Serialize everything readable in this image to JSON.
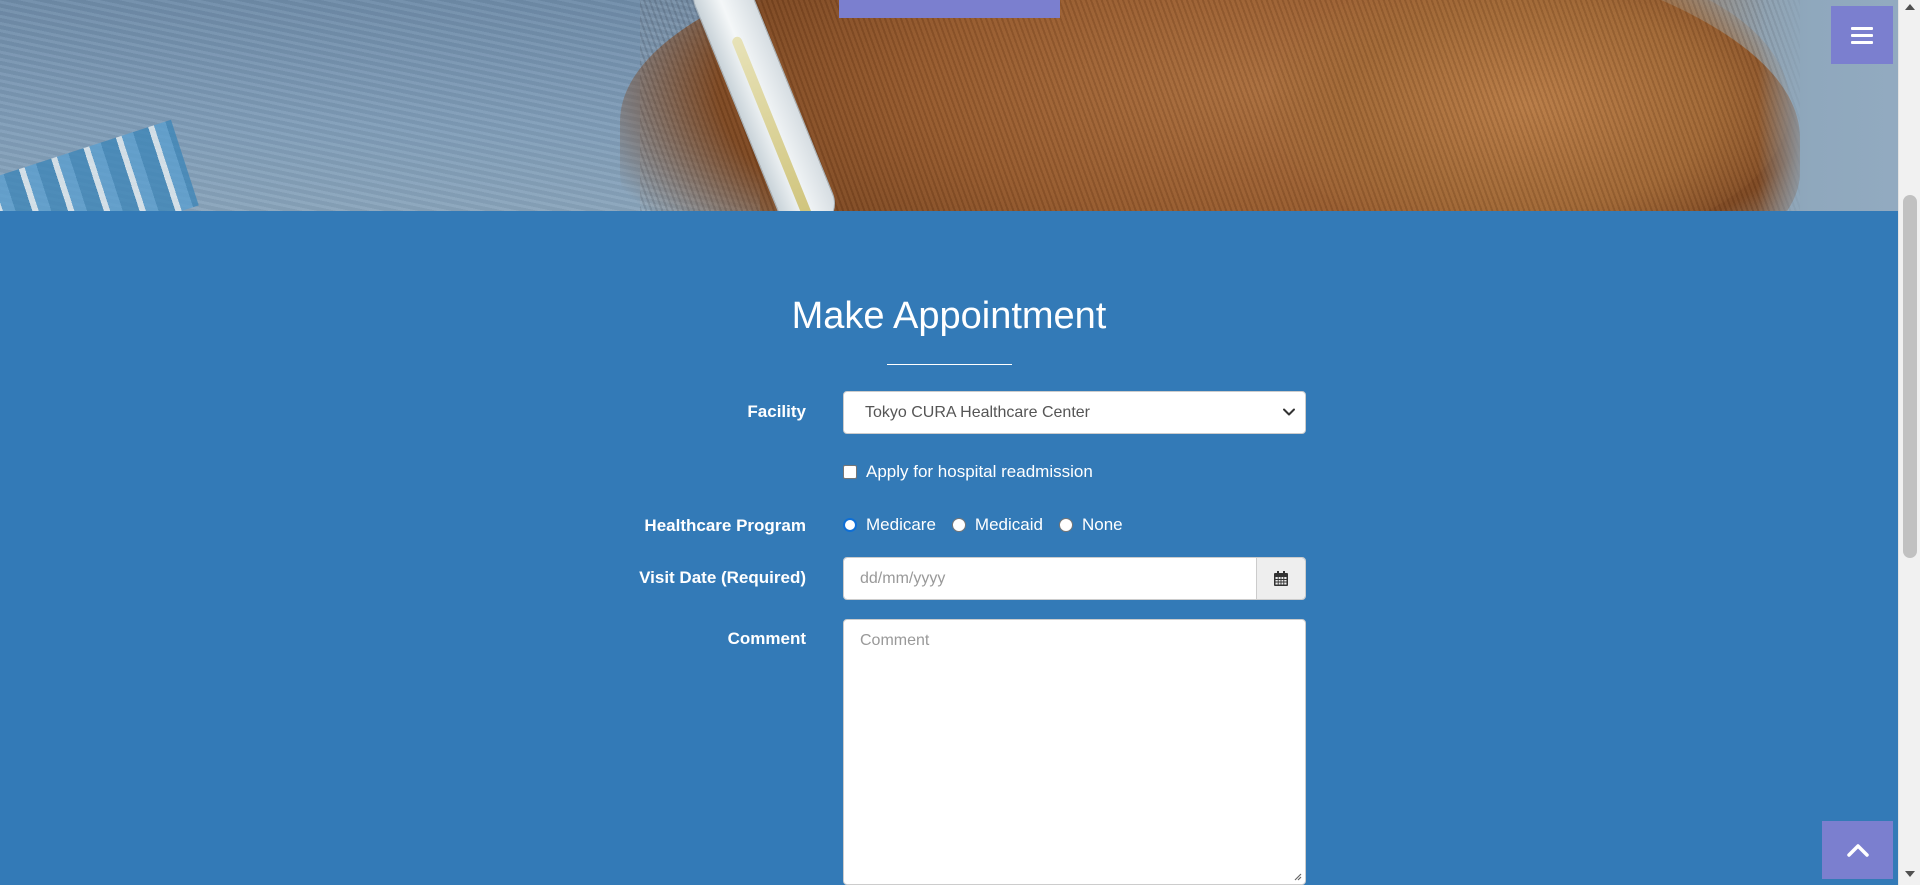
{
  "header": {
    "menu_icon": "bars-icon"
  },
  "appointment": {
    "title": "Make Appointment",
    "facility": {
      "label": "Facility",
      "selected": "Tokyo CURA Healthcare Center",
      "icon": "chevron-down-icon"
    },
    "readmission": {
      "label": "Apply for hospital readmission",
      "checked": false
    },
    "program": {
      "label": "Healthcare Program",
      "options": [
        "Medicare",
        "Medicaid",
        "None"
      ],
      "focused": "Medicare"
    },
    "visit_date": {
      "label": "Visit Date (Required)",
      "placeholder": "dd/mm/yyyy",
      "icon": "calendar-icon"
    },
    "comment": {
      "label": "Comment",
      "placeholder": "Comment"
    }
  },
  "back_to_top": {
    "icon": "chevron-up-icon"
  },
  "colors": {
    "section_bg": "#337ab7",
    "accent": "#7b7fcf"
  }
}
